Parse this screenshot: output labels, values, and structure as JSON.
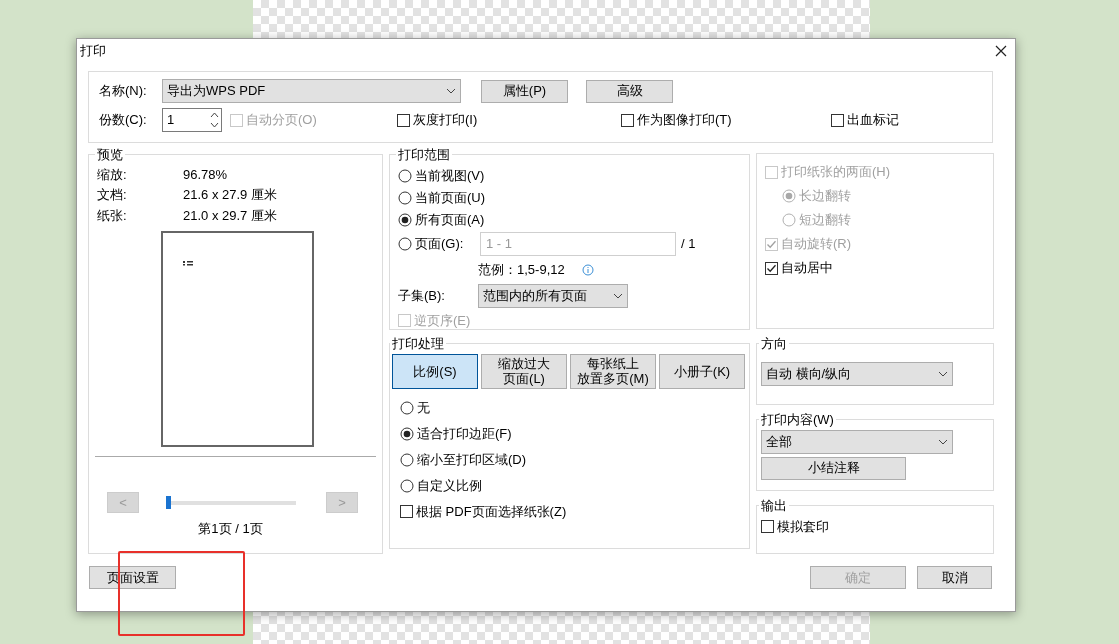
{
  "window": {
    "title": "打印"
  },
  "printer": {
    "label": "名称(N):",
    "value": "导出为WPS PDF",
    "buttons": [
      "属性(P)",
      "高级"
    ]
  },
  "copies": {
    "label": "份数(C):",
    "value": "1"
  },
  "options": [
    {
      "label": "自动分页(O)",
      "checked": false,
      "disabled": true
    },
    {
      "label": "灰度打印(I)",
      "checked": false,
      "disabled": false
    },
    {
      "label": "作为图像打印(T)",
      "checked": false,
      "disabled": false
    },
    {
      "label": "出血标记",
      "checked": false,
      "disabled": false
    }
  ],
  "preview": {
    "title": "预览",
    "info": [
      {
        "label": "缩放:",
        "value": "96.78%"
      },
      {
        "label": "文档:",
        "value": "21.6 x 27.9 厘米"
      },
      {
        "label": "纸张:",
        "value": "21.0 x 29.7 厘米"
      }
    ],
    "prev": "<",
    "next": ">",
    "level": 0,
    "page": "第1页 / 1页"
  },
  "range": {
    "title": "打印范围",
    "options": [
      {
        "kind": "plain",
        "label": "当前视图(V)",
        "selected": false
      },
      {
        "kind": "plain",
        "label": "当前页面(U)",
        "selected": false
      },
      {
        "kind": "plain",
        "label": "所有页面(A)",
        "selected": true
      },
      {
        "kind": "pages",
        "label": "页面(G):",
        "selected": false
      }
    ],
    "pages_value": "1 - 1",
    "pages_total": "/ 1",
    "example": "范例：1,5-9,12",
    "subset_label": "子集(B):",
    "subset_value": "范围内的所有页面",
    "reverse": {
      "label": "逆页序(E)",
      "checked": false,
      "disabled": true
    }
  },
  "processing": {
    "title": "打印处理",
    "tabs": [
      {
        "label": "比例(S)",
        "selected": true
      },
      {
        "label": "缩放过大",
        "label_2": "页面(L)",
        "selected": false
      },
      {
        "label": "每张纸上",
        "label_2": "放置多页(M)",
        "selected": false
      },
      {
        "label": "小册子(K)",
        "selected": false
      }
    ],
    "options": [
      {
        "label": "无",
        "selected": false
      },
      {
        "label": "适合打印边距(F)",
        "selected": true
      },
      {
        "label": "缩小至打印区域(D)",
        "selected": false
      },
      {
        "label": "自定义比例",
        "selected": false
      }
    ],
    "pdf_paper": {
      "label": "根据 PDF页面选择纸张(Z)",
      "checked": false
    }
  },
  "duplex": {
    "items": [
      {
        "kind": "checkbox",
        "label": "打印纸张的两面(H)",
        "checked": false,
        "disabled": true
      },
      {
        "kind": "radio",
        "label": "长边翻转",
        "selected": true,
        "disabled": true
      },
      {
        "kind": "radio",
        "label": "短边翻转",
        "selected": false,
        "disabled": true
      },
      {
        "kind": "checkbox",
        "label": "自动旋转(R)",
        "checked": true,
        "disabled": true
      },
      {
        "kind": "checkbox",
        "label": "自动居中",
        "checked": true,
        "disabled": false
      }
    ]
  },
  "orientation": {
    "title": "方向",
    "value": "自动 横向/纵向"
  },
  "content": {
    "title": "打印内容(W)",
    "value": "全部",
    "button": "小结注释"
  },
  "output": {
    "title": "输出",
    "items": [
      {
        "label": "模拟套印",
        "checked": false,
        "disabled": false
      }
    ]
  },
  "footer": {
    "page_setup": "页面设置",
    "ok": {
      "label": "确定",
      "disabled": true
    },
    "cancel": "取消"
  }
}
